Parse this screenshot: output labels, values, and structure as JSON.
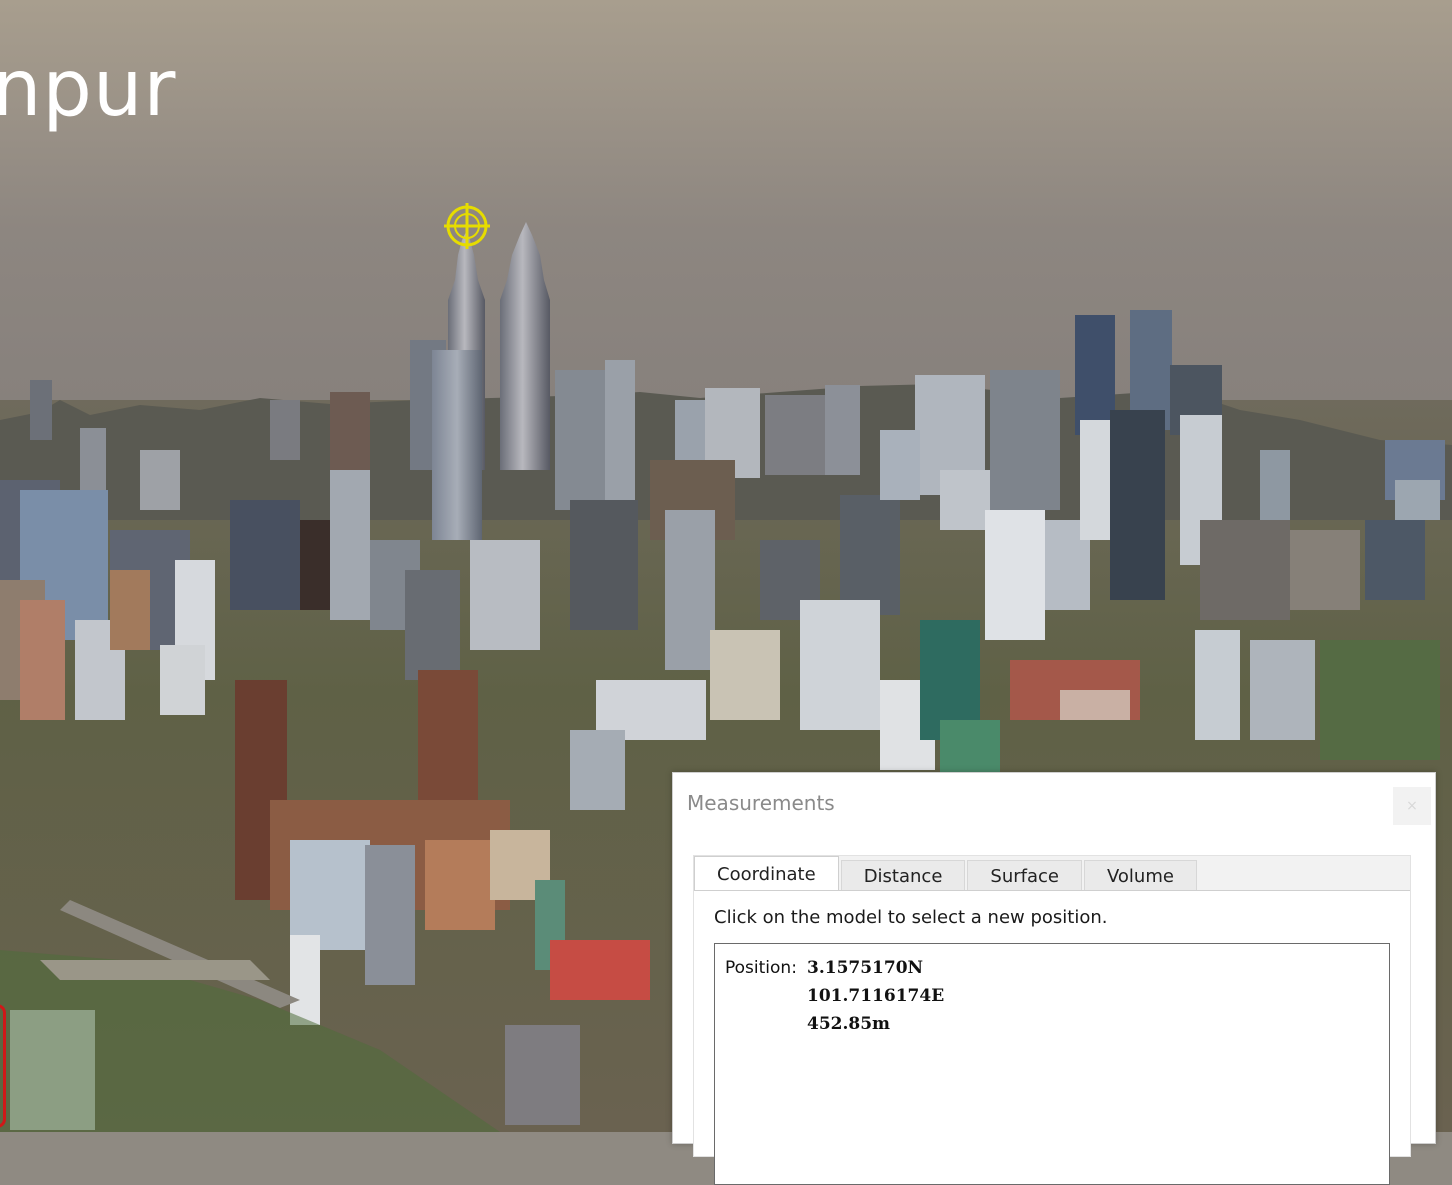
{
  "scene": {
    "title_fragment": "npur",
    "marker_color": "#e6dc00"
  },
  "measurements": {
    "title": "Measurements",
    "close_label": "×",
    "tabs": [
      {
        "label": "Coordinate",
        "active": true
      },
      {
        "label": "Distance",
        "active": false
      },
      {
        "label": "Surface",
        "active": false
      },
      {
        "label": "Volume",
        "active": false
      }
    ],
    "instruction": "Click on the model to select a new position.",
    "position": {
      "label": "Position:",
      "latitude": "3.1575170N",
      "longitude": "101.7116174E",
      "altitude": "452.85m"
    }
  }
}
